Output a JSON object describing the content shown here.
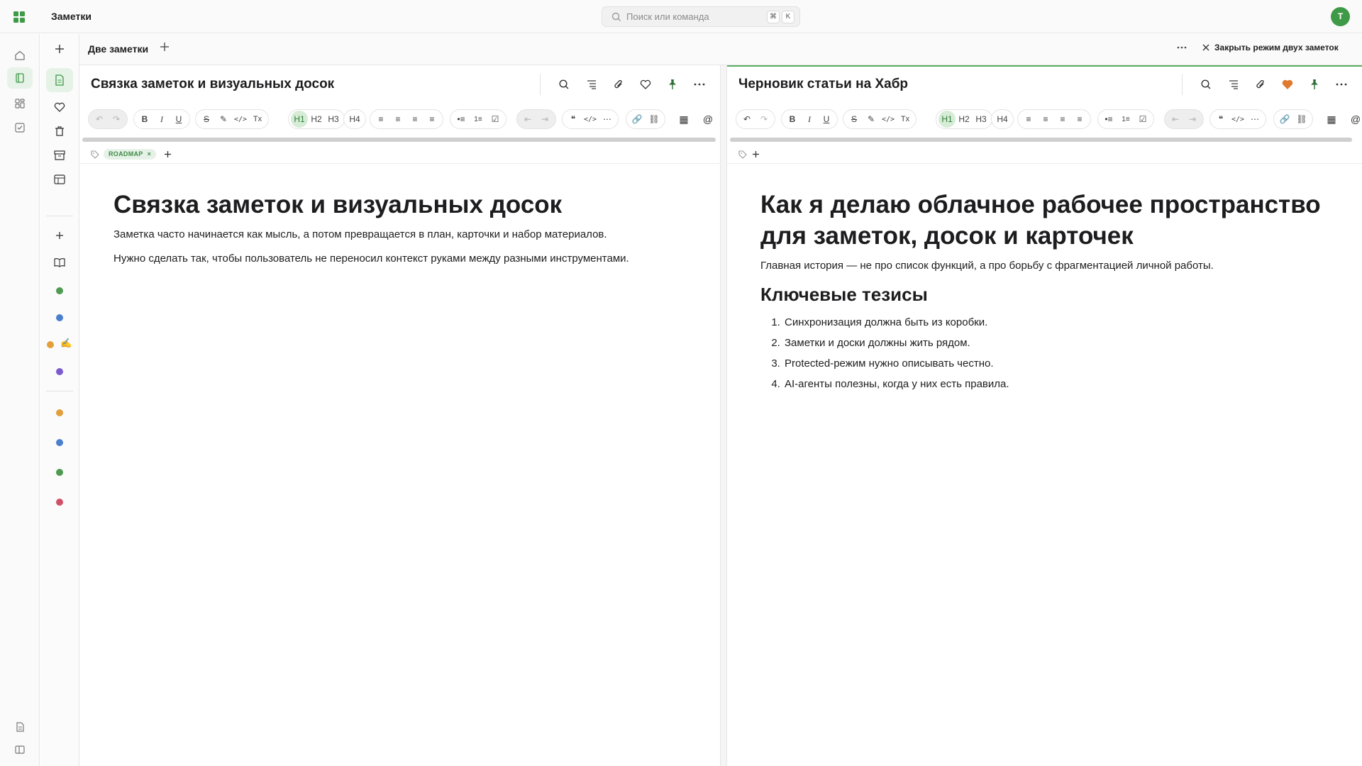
{
  "app": {
    "title": "Заметки",
    "user_initial": "T",
    "accent": "#3f9a48"
  },
  "search": {
    "placeholder": "Поиск или команда",
    "key1": "⌘",
    "key2": "K"
  },
  "tab": {
    "title": "Две заметки",
    "close_label": "Закрыть режим двух заметок"
  },
  "left_note": {
    "title": "Связка заметок и визуальных досок",
    "tag": "ROADMAP",
    "heading": "Связка заметок и визуальных досок",
    "paragraphs": [
      "Заметка часто начинается как мысль, а потом превращается в план, карточки и набор материалов.",
      "Нужно сделать так, чтобы пользователь не переносил контекст руками между разными инструментами."
    ]
  },
  "right_note": {
    "title": "Черновик статьи на Хабр",
    "heading": "Как я делаю облачное рабочее пространство для заметок, досок и карточек",
    "paragraph": "Главная история — не про список функций, а про борьбу с фрагментацией личной работы.",
    "subheading": "Ключевые тезисы",
    "items": [
      "Синхронизация должна быть из коробки.",
      "Заметки и доски должны жить рядом.",
      "Protected-режим нужно описывать честно.",
      "AI-агенты полезны, когда у них есть правила."
    ]
  },
  "toolbar_labels": {
    "h1": "H1",
    "h2": "H2",
    "h3": "H3",
    "h4": "H4",
    "bold": "B",
    "italic": "I",
    "underline": "U",
    "strike": "S",
    "clear": "Tx",
    "mention": "@"
  },
  "sidebar_colors": [
    "#4e9a52",
    "#4a7fd0",
    "#e3a03a",
    "#7a5cd0",
    "#e3a03a",
    "#4a7fd0",
    "#4e9a52",
    "#d0506a"
  ]
}
